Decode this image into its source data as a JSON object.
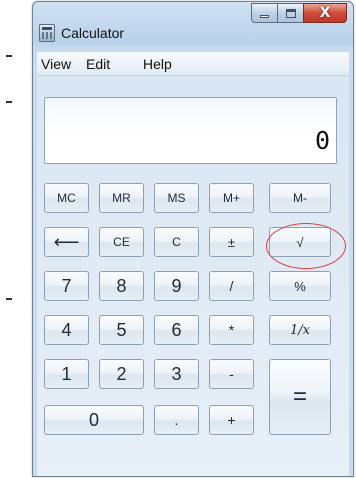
{
  "window": {
    "title": "Calculator",
    "controls": {
      "close_glyph": "X"
    }
  },
  "menu": [
    "View",
    "Edit",
    "Help"
  ],
  "display": {
    "value": "0"
  },
  "buttons": {
    "mc": "MC",
    "mr": "MR",
    "ms": "MS",
    "mplus": "M+",
    "mminus": "M-",
    "back": "⟵",
    "ce": "CE",
    "c": "C",
    "plusminus": "±",
    "sqrt": "√",
    "seven": "7",
    "eight": "8",
    "nine": "9",
    "divide": "/",
    "percent": "%",
    "four": "4",
    "five": "5",
    "six": "6",
    "multiply": "*",
    "reciprocal": "1/x",
    "one": "1",
    "two": "2",
    "three": "3",
    "minus": "-",
    "equals": "=",
    "zero": "0",
    "decimal": ".",
    "plus": "+"
  },
  "annotation": {
    "color": "#e23c3c",
    "target": "sqrt-button"
  }
}
